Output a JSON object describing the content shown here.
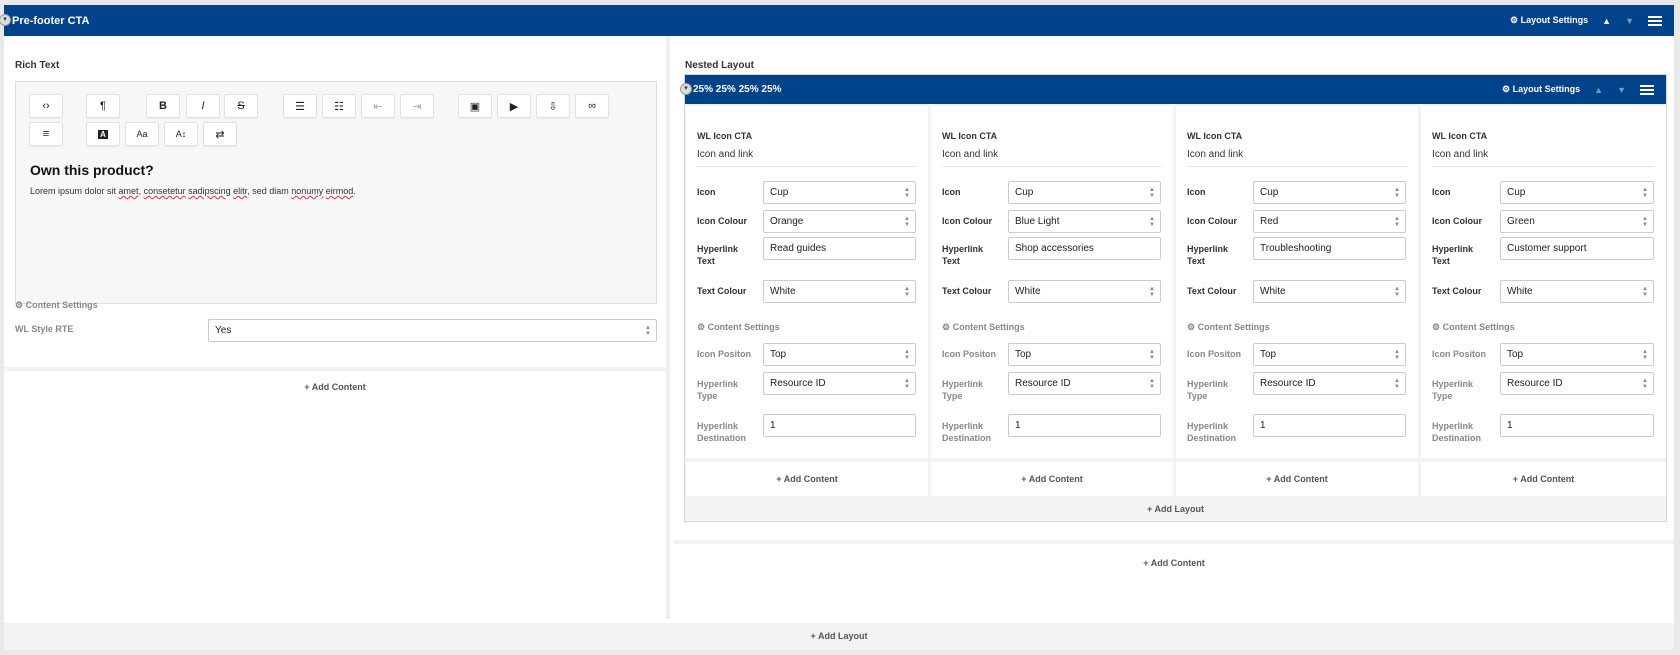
{
  "outer": {
    "title": "Pre-footer CTA",
    "layout_settings": "Layout Settings",
    "add_layout": "+ Add Layout"
  },
  "left": {
    "rich_text_label": "Rich Text",
    "heading": "Own this product?",
    "para_parts": [
      "Lorem ipsum dolor sit ",
      "amet",
      ", ",
      "consetetur",
      " ",
      "sadipscing",
      " ",
      "elitr",
      ", sed diam ",
      "nonumy",
      " ",
      "eirmod",
      "."
    ],
    "content_settings": "Content Settings",
    "wl_style_label": "WL Style RTE",
    "wl_style_value": "Yes",
    "add_content": "+ Add Content"
  },
  "right": {
    "nested_label": "Nested Layout",
    "nested_title": "25% 25% 25% 25%",
    "layout_settings": "Layout Settings",
    "add_layout": "+ Add Layout",
    "add_content": "+ Add Content",
    "columns": [
      {
        "widget": "WL Icon CTA",
        "subtitle": "Icon and link",
        "icon": "Cup",
        "icon_colour": "Orange",
        "hyperlink_text": "Read guides",
        "text_colour": "White",
        "icon_position": "Top",
        "hyperlink_type": "Resource ID",
        "hyperlink_destination": "1",
        "add_content": "+ Add Content"
      },
      {
        "widget": "WL Icon CTA",
        "subtitle": "Icon and link",
        "icon": "Cup",
        "icon_colour": "Blue Light",
        "hyperlink_text": "Shop accessories",
        "text_colour": "White",
        "icon_position": "Top",
        "hyperlink_type": "Resource ID",
        "hyperlink_destination": "1",
        "add_content": "+ Add Content"
      },
      {
        "widget": "WL Icon CTA",
        "subtitle": "Icon and link",
        "icon": "Cup",
        "icon_colour": "Red",
        "hyperlink_text": "Troubleshooting",
        "text_colour": "White",
        "icon_position": "Top",
        "hyperlink_type": "Resource ID",
        "hyperlink_destination": "1",
        "add_content": "+ Add Content"
      },
      {
        "widget": "WL Icon CTA",
        "subtitle": "Icon and link",
        "icon": "Cup",
        "icon_colour": "Green",
        "hyperlink_text": "Customer support",
        "text_colour": "White",
        "icon_position": "Top",
        "hyperlink_type": "Resource ID",
        "hyperlink_destination": "1",
        "add_content": "+ Add Content"
      }
    ]
  },
  "labels": {
    "icon": "Icon",
    "icon_colour": "Icon Colour",
    "hyperlink_text_1": "Hyperlink",
    "hyperlink_text_2": "Text",
    "text_colour": "Text Colour",
    "content_settings": "Content Settings",
    "icon_position": "Icon Positon",
    "hyperlink_type_1": "Hyperlink",
    "hyperlink_type_2": "Type",
    "hyperlink_dest_1": "Hyperlink",
    "hyperlink_dest_2": "Destination"
  },
  "toolbar_icons": [
    "code-icon",
    "paragraph-icon",
    "bold-icon",
    "italic-icon",
    "strikethrough-icon",
    "bullet-list-icon",
    "numbered-list-icon",
    "outdent-icon",
    "indent-icon",
    "image-icon",
    "video-icon",
    "embed-icon",
    "link-icon",
    "align-icon",
    "text-color-icon",
    "font-size-icon",
    "line-height-icon",
    "direction-icon"
  ],
  "colors": {
    "brand_bar": "#00438a",
    "background": "#e9e9e9"
  }
}
